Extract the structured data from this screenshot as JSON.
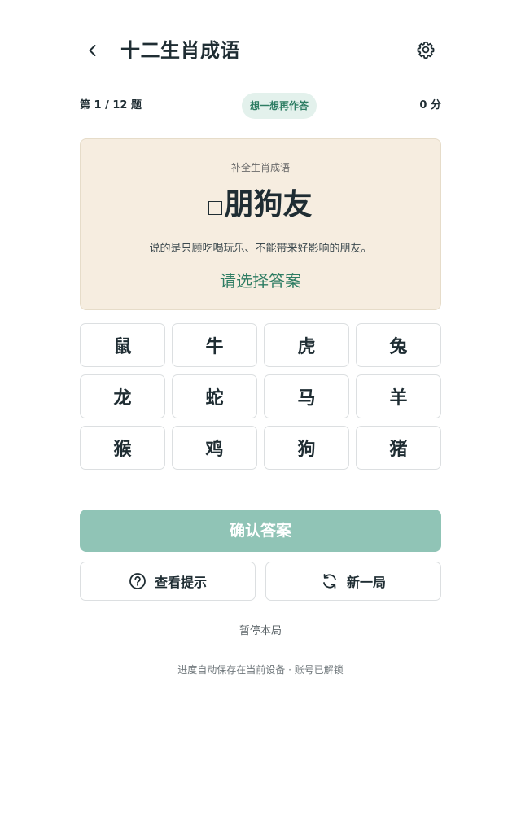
{
  "header": {
    "title": "十二生肖成语",
    "back_icon": "chevron-left-icon",
    "settings_icon": "gear-icon"
  },
  "status": {
    "progress": "第 1 / 12 题",
    "hint_pill": "想一想再作答",
    "score": "0 分"
  },
  "question": {
    "subtitle": "补全生肖成语",
    "idiom_rest": "朋狗友",
    "description": "说的是只顾吃喝玩乐、不能带来好影响的朋友。",
    "prompt": "请选择答案"
  },
  "options": [
    "鼠",
    "牛",
    "虎",
    "兔",
    "龙",
    "蛇",
    "马",
    "羊",
    "猴",
    "鸡",
    "狗",
    "猪"
  ],
  "actions": {
    "confirm": "确认答案",
    "hint": "查看提示",
    "hint_icon": "question-circle-icon",
    "new_game": "新一局",
    "new_game_icon": "refresh-icon",
    "pause": "暂停本局"
  },
  "footer": "进度自动保存在当前设备 · 账号已解锁",
  "colors": {
    "accent": "#2e7d63",
    "confirm_bg": "#90c4b6",
    "card_bg": "#f6ede0",
    "pill_bg": "#e3f1ec"
  }
}
